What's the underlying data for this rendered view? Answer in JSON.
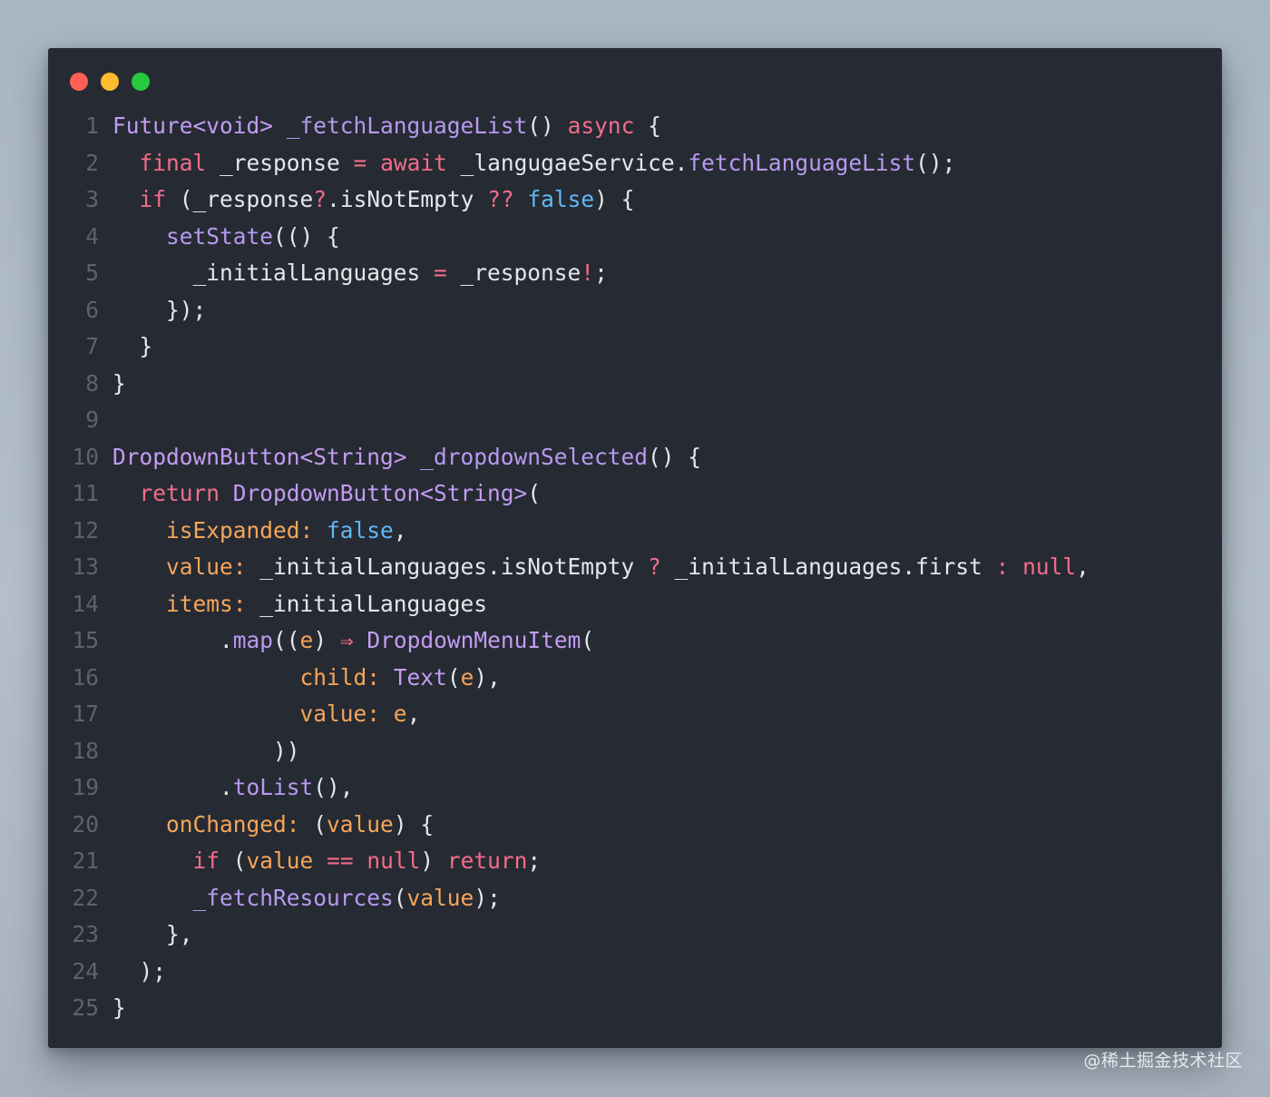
{
  "window": {
    "controls": [
      "close",
      "minimize",
      "maximize"
    ]
  },
  "code_lines": [
    [
      [
        "Future<void>",
        "type"
      ],
      [
        " ",
        "pl"
      ],
      [
        "_fetchLanguageList",
        "fn"
      ],
      [
        "() ",
        "pl"
      ],
      [
        "async",
        "kw"
      ],
      [
        " {",
        "pl"
      ]
    ],
    [
      [
        "  ",
        "pl"
      ],
      [
        "final",
        "kw"
      ],
      [
        " _response ",
        "pl"
      ],
      [
        "=",
        "op"
      ],
      [
        " ",
        "pl"
      ],
      [
        "await",
        "kw"
      ],
      [
        " _langugaeService.",
        "pl"
      ],
      [
        "fetchLanguageList",
        "fn"
      ],
      [
        "();",
        "pl"
      ]
    ],
    [
      [
        "  ",
        "pl"
      ],
      [
        "if",
        "kw"
      ],
      [
        " (_response",
        "pl"
      ],
      [
        "?",
        "op"
      ],
      [
        ".isNotEmpty ",
        "pl"
      ],
      [
        "??",
        "op"
      ],
      [
        " ",
        "pl"
      ],
      [
        "false",
        "bool"
      ],
      [
        ") {",
        "pl"
      ]
    ],
    [
      [
        "    ",
        "pl"
      ],
      [
        "setState",
        "fn"
      ],
      [
        "(() {",
        "pl"
      ]
    ],
    [
      [
        "      _initialLanguages ",
        "pl"
      ],
      [
        "=",
        "op"
      ],
      [
        " _response",
        "pl"
      ],
      [
        "!",
        "op"
      ],
      [
        ";",
        "pl"
      ]
    ],
    [
      [
        "    });",
        "pl"
      ]
    ],
    [
      [
        "  }",
        "pl"
      ]
    ],
    [
      [
        "}",
        "pl"
      ]
    ],
    [],
    [
      [
        "DropdownButton<String>",
        "type"
      ],
      [
        " ",
        "pl"
      ],
      [
        "_dropdownSelected",
        "fn"
      ],
      [
        "() {",
        "pl"
      ]
    ],
    [
      [
        "  ",
        "pl"
      ],
      [
        "return",
        "kw"
      ],
      [
        " ",
        "pl"
      ],
      [
        "DropdownButton<String>",
        "type"
      ],
      [
        "(",
        "pl"
      ]
    ],
    [
      [
        "    ",
        "pl"
      ],
      [
        "isExpanded:",
        "prop"
      ],
      [
        " ",
        "pl"
      ],
      [
        "false",
        "bool"
      ],
      [
        ",",
        "pl"
      ]
    ],
    [
      [
        "    ",
        "pl"
      ],
      [
        "value:",
        "prop"
      ],
      [
        " _initialLanguages.isNotEmpty ",
        "pl"
      ],
      [
        "?",
        "op"
      ],
      [
        " _initialLanguages.first ",
        "pl"
      ],
      [
        ":",
        "op"
      ],
      [
        " ",
        "pl"
      ],
      [
        "null",
        "kw"
      ],
      [
        ",",
        "pl"
      ]
    ],
    [
      [
        "    ",
        "pl"
      ],
      [
        "items:",
        "prop"
      ],
      [
        " _initialLanguages",
        "pl"
      ]
    ],
    [
      [
        "        .",
        "pl"
      ],
      [
        "map",
        "fn"
      ],
      [
        "((",
        "pl"
      ],
      [
        "e",
        "prop"
      ],
      [
        ") ",
        "pl"
      ],
      [
        "⇒",
        "op"
      ],
      [
        " ",
        "pl"
      ],
      [
        "DropdownMenuItem",
        "type"
      ],
      [
        "(",
        "pl"
      ]
    ],
    [
      [
        "              ",
        "pl"
      ],
      [
        "child:",
        "prop"
      ],
      [
        " ",
        "pl"
      ],
      [
        "Text",
        "type"
      ],
      [
        "(",
        "pl"
      ],
      [
        "e",
        "prop"
      ],
      [
        "),",
        "pl"
      ]
    ],
    [
      [
        "              ",
        "pl"
      ],
      [
        "value:",
        "prop"
      ],
      [
        " ",
        "pl"
      ],
      [
        "e",
        "prop"
      ],
      [
        ",",
        "pl"
      ]
    ],
    [
      [
        "            ))",
        "pl"
      ]
    ],
    [
      [
        "        .",
        "pl"
      ],
      [
        "toList",
        "fn"
      ],
      [
        "(),",
        "pl"
      ]
    ],
    [
      [
        "    ",
        "pl"
      ],
      [
        "onChanged:",
        "prop"
      ],
      [
        " (",
        "pl"
      ],
      [
        "value",
        "prop"
      ],
      [
        ") {",
        "pl"
      ]
    ],
    [
      [
        "      ",
        "pl"
      ],
      [
        "if",
        "kw"
      ],
      [
        " (",
        "pl"
      ],
      [
        "value",
        "prop"
      ],
      [
        " ",
        "pl"
      ],
      [
        "==",
        "op"
      ],
      [
        " ",
        "pl"
      ],
      [
        "null",
        "kw"
      ],
      [
        ") ",
        "pl"
      ],
      [
        "return",
        "kw"
      ],
      [
        ";",
        "pl"
      ]
    ],
    [
      [
        "      ",
        "pl"
      ],
      [
        "_fetchResources",
        "fn"
      ],
      [
        "(",
        "pl"
      ],
      [
        "value",
        "prop"
      ],
      [
        ");",
        "pl"
      ]
    ],
    [
      [
        "    },",
        "pl"
      ]
    ],
    [
      [
        "  );",
        "pl"
      ]
    ],
    [
      [
        "}",
        "pl"
      ]
    ]
  ],
  "watermark": "@稀土掘金技术社区"
}
